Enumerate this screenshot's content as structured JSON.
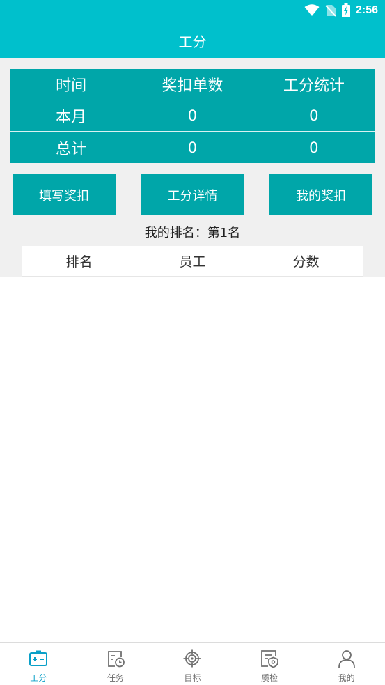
{
  "status_bar": {
    "time": "2:56"
  },
  "header": {
    "title": "工分"
  },
  "stats": {
    "headers": [
      "时间",
      "奖扣单数",
      "工分统计"
    ],
    "rows": [
      {
        "label": "本月",
        "count": "0",
        "score": "0"
      },
      {
        "label": "总计",
        "count": "0",
        "score": "0"
      }
    ]
  },
  "actions": {
    "fill_reward": "填写奖扣",
    "score_detail": "工分详情",
    "my_reward": "我的奖扣"
  },
  "ranking": {
    "my_rank": "我的排名：第1名",
    "columns": [
      "排名",
      "员工",
      "分数"
    ]
  },
  "nav": {
    "active_color": "#0aa0c8",
    "items": [
      {
        "label": "工分",
        "icon": "score-icon"
      },
      {
        "label": "任务",
        "icon": "task-icon"
      },
      {
        "label": "目标",
        "icon": "target-icon"
      },
      {
        "label": "质检",
        "icon": "quality-check-icon"
      },
      {
        "label": "我的",
        "icon": "profile-icon"
      }
    ]
  },
  "colors": {
    "header": "#00c0cc",
    "table": "#00a6a9",
    "background": "#f0f0f0"
  }
}
